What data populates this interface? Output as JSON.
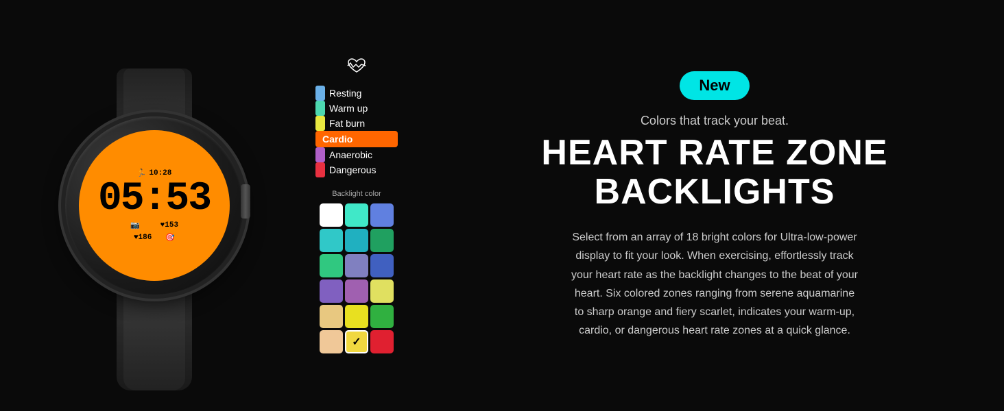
{
  "badge": {
    "label": "New"
  },
  "subtitle": "Colors that track your beat.",
  "main_title": "HEART RATE ZONE\nBACKLIGHTS",
  "description": "Select from an array of 18 bright colors for Ultra-low-power display to fit your look. When exercising, effortlessly track your heart rate as the backlight changes to the beat of your heart. Six colored zones ranging from serene aquamarine to sharp orange and fiery scarlet, indicates your warm-up, cardio, or dangerous heart rate zones at a quick glance.",
  "backlight_label": "Backlight color",
  "zones": [
    {
      "id": "resting",
      "label": "Resting",
      "color": "#6ab0e8",
      "active": false
    },
    {
      "id": "warmup",
      "label": "Warm up",
      "color": "#4dd8b0",
      "active": false
    },
    {
      "id": "fatburn",
      "label": "Fat burn",
      "color": "#e8e840",
      "active": false
    },
    {
      "id": "cardio",
      "label": "Cardio",
      "color": "#ff6600",
      "active": true
    },
    {
      "id": "anaerobic",
      "label": "Anaerobic",
      "color": "#b060c8",
      "active": false
    },
    {
      "id": "dangerous",
      "label": "Dangerous",
      "color": "#e83040",
      "active": false
    }
  ],
  "colors": [
    "#ffffff",
    "#40e8c8",
    "#6080e0",
    "#30c8c8",
    "#20b0c0",
    "#20a060",
    "#30c880",
    "#8080c0",
    "#4060c0",
    "#8060c0",
    "#a060b0",
    "#e0e060",
    "#e8c880",
    "#e8e020",
    "#30b040",
    "#f0c898",
    "#f0d840",
    "#e02030"
  ],
  "selected_color_index": 16,
  "watch": {
    "time_top": "10:28",
    "time_main": "05:53",
    "steps": "186",
    "heart": "153",
    "calories": "153"
  }
}
